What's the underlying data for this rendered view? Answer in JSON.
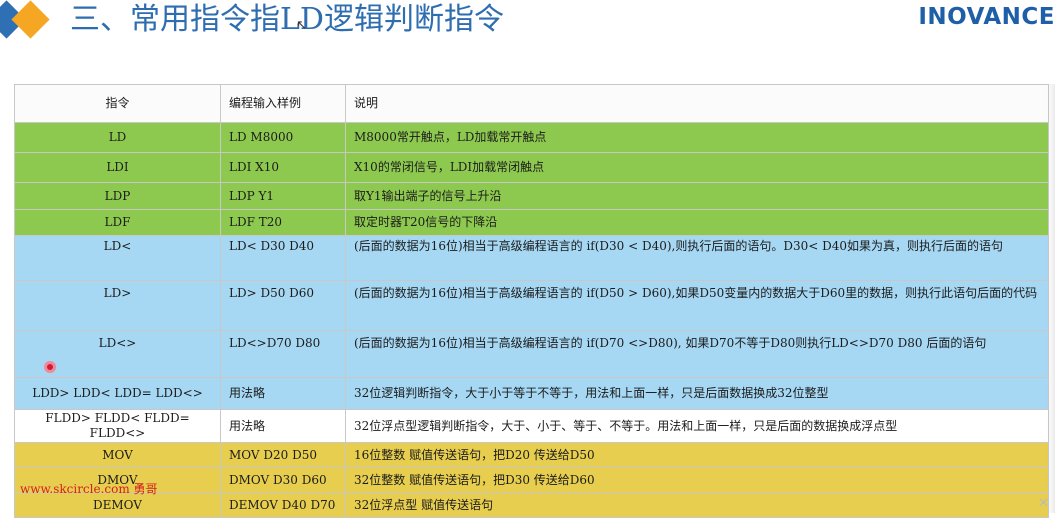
{
  "header": {
    "title": "三、常用指令指LD逻辑判断指令",
    "logo": "INOVANCE"
  },
  "table": {
    "columns": [
      "指令",
      "编程输入样例",
      "说明"
    ],
    "rows": [
      {
        "color": "green",
        "instr": "LD",
        "example": "LD M8000",
        "desc": "M8000常开触点，LD加载常开触点"
      },
      {
        "color": "green",
        "instr": "LDI",
        "example": "LDI X10",
        "desc": "X10的常闭信号，LDI加载常闭触点"
      },
      {
        "color": "green",
        "instr": "LDP",
        "example": "LDP Y1",
        "desc": "取Y1输出端子的信号上升沿"
      },
      {
        "color": "green",
        "instr": "LDF",
        "example": "LDF T20",
        "desc": "取定时器T20信号的下降沿"
      },
      {
        "color": "blue",
        "instr": "LD<",
        "example": "LD< D30 D40",
        "desc": "(后面的数据为16位)相当于高级编程语言的 if(D30 < D40),则执行后面的语句。D30< D40如果为真，则执行后面的语句"
      },
      {
        "color": "blue",
        "instr": "LD>",
        "example": "LD> D50 D60",
        "desc": "(后面的数据为16位)相当于高级编程语言的 if(D50 > D60),如果D50变量内的数据大于D60里的数据，则执行此语句后面的代码"
      },
      {
        "color": "blue",
        "instr": "LD<>",
        "example": "LD<>D70 D80",
        "desc": "(后面的数据为16位)相当于高级编程语言的 if(D70 <>D80), 如果D70不等于D80则执行LD<>D70 D80 后面的语句"
      },
      {
        "color": "blue",
        "instr": "LDD> LDD< LDD= LDD<>",
        "example": "用法略",
        "desc": "32位逻辑判断指令，大于小于等于不等于，用法和上面一样，只是后面数据换成32位整型"
      },
      {
        "color": "white",
        "instr": "FLDD> FLDD< FLDD= FLDD<>",
        "example": "用法略",
        "desc": "32位浮点型逻辑判断指令，大于、小于、等于、不等于。用法和上面一样，只是后面的数据换成浮点型"
      },
      {
        "color": "yellow",
        "instr": "MOV",
        "example": "MOV D20 D50",
        "desc": "16位整数 赋值传送语句，把D20 传送给D50"
      },
      {
        "color": "yellow",
        "instr": "DMOV",
        "example": "DMOV D30 D60",
        "desc": "32位整数 赋值传送语句，把D30 传送给D60"
      },
      {
        "color": "yellow",
        "instr": "DEMOV",
        "example": "DEMOV D40 D70",
        "desc": "32位浮点型 赋值传送语句"
      }
    ]
  },
  "watermark": "www.skcircle.com 勇哥"
}
